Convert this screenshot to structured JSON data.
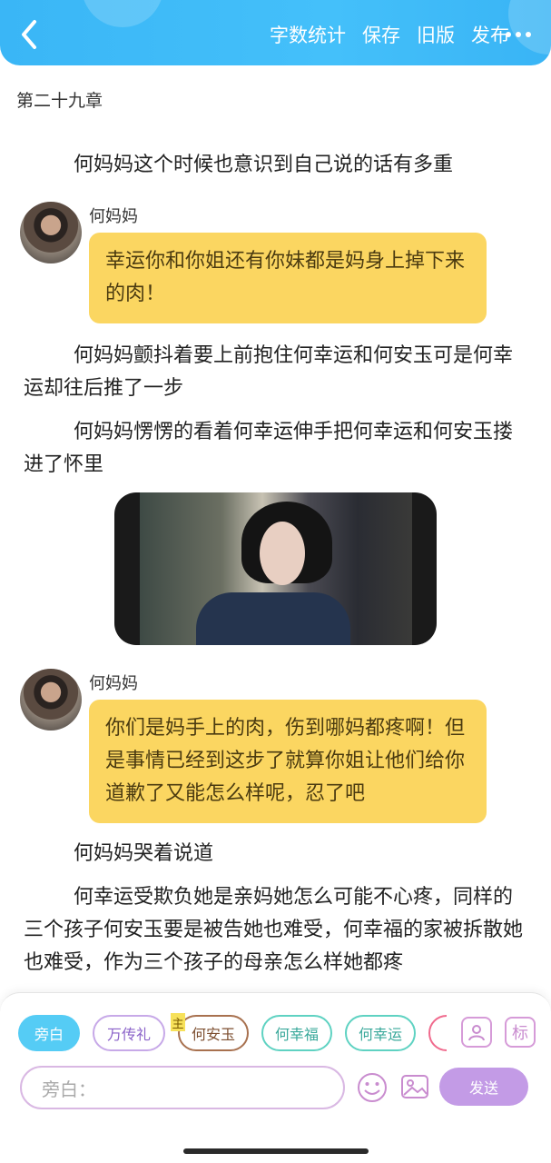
{
  "header": {
    "back_icon": "chevron-left-icon",
    "actions": [
      "字数统计",
      "保存",
      "旧版",
      "发布"
    ],
    "more_icon": "more-dots-icon",
    "colors": {
      "bar": "#3ab6f6"
    }
  },
  "chapter_title": "第二十九章",
  "content": {
    "p1": "何妈妈这个时候也意识到自己说的话有多重",
    "dialog1": {
      "speaker": "何妈妈",
      "text": "幸运你和你姐还有你妹都是妈身上掉下来的肉！"
    },
    "p2": "何妈妈颤抖着要上前抱住何幸运和何安玉可是何幸运却往后推了一步",
    "p3": "何妈妈愣愣的看着何幸运伸手把何幸运和何安玉搂进了怀里",
    "dialog2": {
      "speaker": "何妈妈",
      "text": "你们是妈手上的肉，伤到哪妈都疼啊！但是事情已经到这步了就算你姐让他们给你道歉了又能怎么样呢，忍了吧"
    },
    "p4": "何妈妈哭着说道",
    "p5": "何幸运受欺负她是亲妈她怎么可能不心疼，同样的三个孩子何安玉要是被告她也难受，何幸福的家被拆散她也难受，作为三个孩子的母亲怎么样她都疼"
  },
  "composer": {
    "chips": [
      "旁白",
      "万传礼",
      "何安玉",
      "何幸福",
      "何幸运"
    ],
    "main_tag": "主",
    "avatar_tool_icon": "person-card-icon",
    "tag_tool_label": "标",
    "input_placeholder": "旁白：",
    "emoji_icon": "smiley-icon",
    "image_icon": "image-icon",
    "send_label": "发送",
    "colors": {
      "narration_chip": "#55ccf5",
      "send": "#c39be6",
      "bubble": "#fbd661"
    }
  }
}
